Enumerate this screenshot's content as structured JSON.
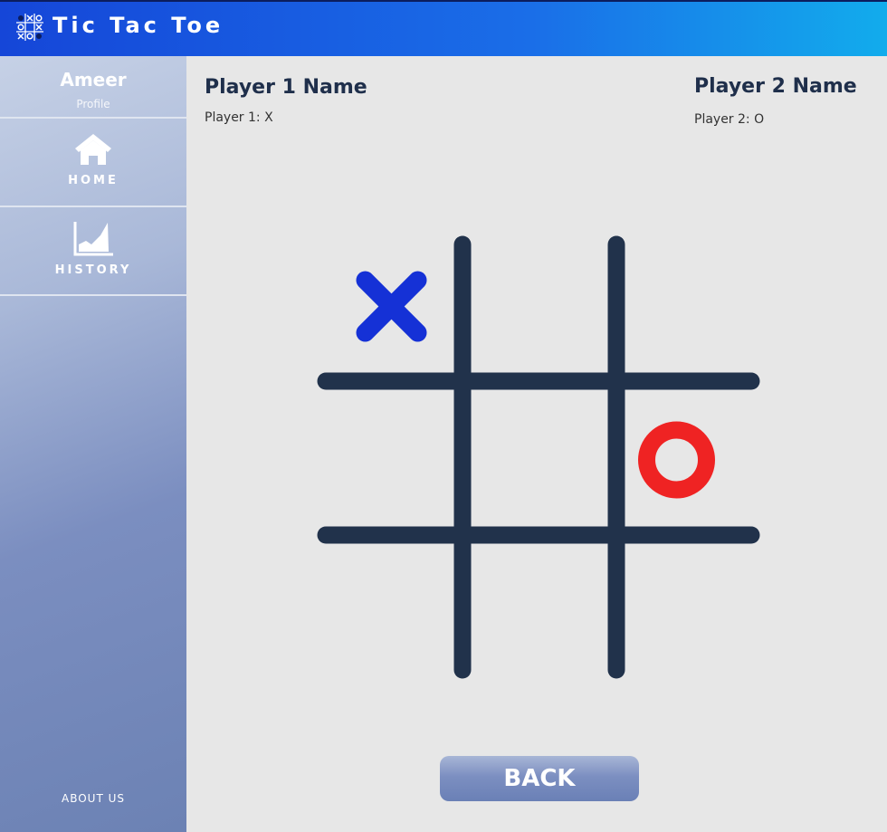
{
  "app": {
    "title": "Tic Tac Toe",
    "logo_icon": "tic-tac-toe-grid-icon"
  },
  "sidebar": {
    "username": "Ameer",
    "profile_label": "Profile",
    "items": [
      {
        "label": "HOME",
        "icon": "home-icon"
      },
      {
        "label": "HISTORY",
        "icon": "chart-icon"
      }
    ],
    "about_label": "ABOUT US"
  },
  "players": {
    "p1": {
      "name": "Player 1 Name",
      "mark": "Player 1: X"
    },
    "p2": {
      "name": "Player 2 Name",
      "mark": "Player 2: O"
    }
  },
  "board": {
    "cells": [
      "X",
      "",
      "",
      "",
      "",
      "O",
      "",
      "",
      ""
    ],
    "colors": {
      "x": "#1531d6",
      "o": "#ef2323",
      "grid": "#21324b"
    }
  },
  "back_label": "BACK",
  "colors": {
    "header_start": "#1546d8",
    "header_end": "#12acec",
    "background": "#e7e7e7"
  }
}
